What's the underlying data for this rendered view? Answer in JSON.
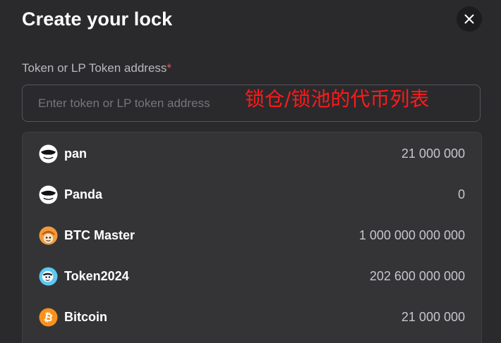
{
  "modal": {
    "title": "Create your lock",
    "close_icon": "close-icon"
  },
  "form": {
    "label": "Token or LP Token address",
    "required_mark": "*",
    "placeholder": "Enter token or LP token address",
    "value": ""
  },
  "annotation": {
    "text": "锁仓/锁池的代币列表",
    "color": "#ff1a1a"
  },
  "tokens": [
    {
      "name": "pan",
      "amount": "21 000 000",
      "icon": "panda-icon"
    },
    {
      "name": "Panda",
      "amount": "0",
      "icon": "panda-icon"
    },
    {
      "name": "BTC Master",
      "amount": "1 000 000 000 000",
      "icon": "btc-master-icon"
    },
    {
      "name": "Token2024",
      "amount": "202 600 000 000",
      "icon": "token2024-icon"
    },
    {
      "name": "Bitcoin",
      "amount": "21 000 000",
      "icon": "bitcoin-icon"
    }
  ],
  "colors": {
    "background": "#2a2a2d",
    "list_background": "#343437",
    "required": "#ff4d4f",
    "bitcoin": "#f7931a"
  }
}
